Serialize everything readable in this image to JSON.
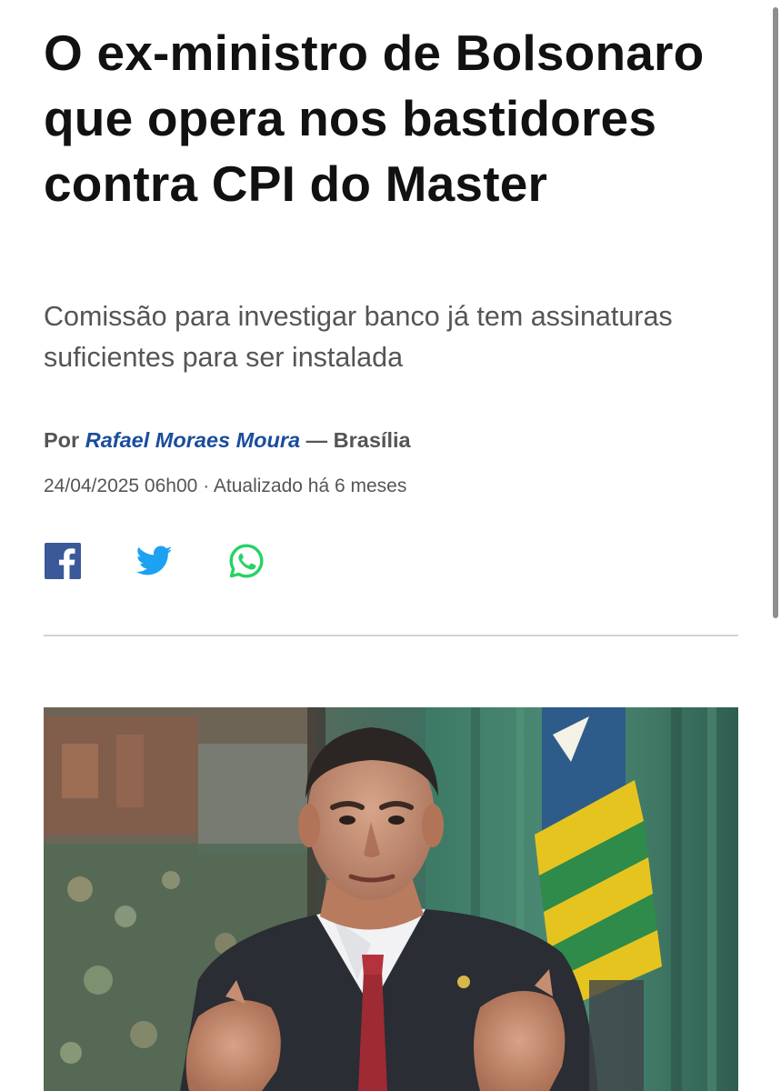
{
  "article": {
    "headline": "O ex-ministro de Bolsonaro que opera nos bastidores contra CPI do Master",
    "subtitle": "Comissão para investigar banco já tem assinaturas suficientes para ser instalada",
    "byline": {
      "prefix": "Por",
      "author": "Rafael Moraes Moura",
      "separator": "—",
      "location": "Brasília"
    },
    "dateline": {
      "published": "24/04/2025 06h00",
      "separator": "·",
      "updated": "Atualizado há 6 meses"
    }
  },
  "share": [
    {
      "icon": "facebook-icon",
      "color": "#3b5998"
    },
    {
      "icon": "twitter-icon",
      "color": "#1da1f2"
    },
    {
      "icon": "whatsapp-icon",
      "color": "#25d366"
    }
  ],
  "colors": {
    "headline": "#111111",
    "secondary_text": "#555555",
    "author_link": "#1a4d9c",
    "divider": "#d4d4d4"
  }
}
